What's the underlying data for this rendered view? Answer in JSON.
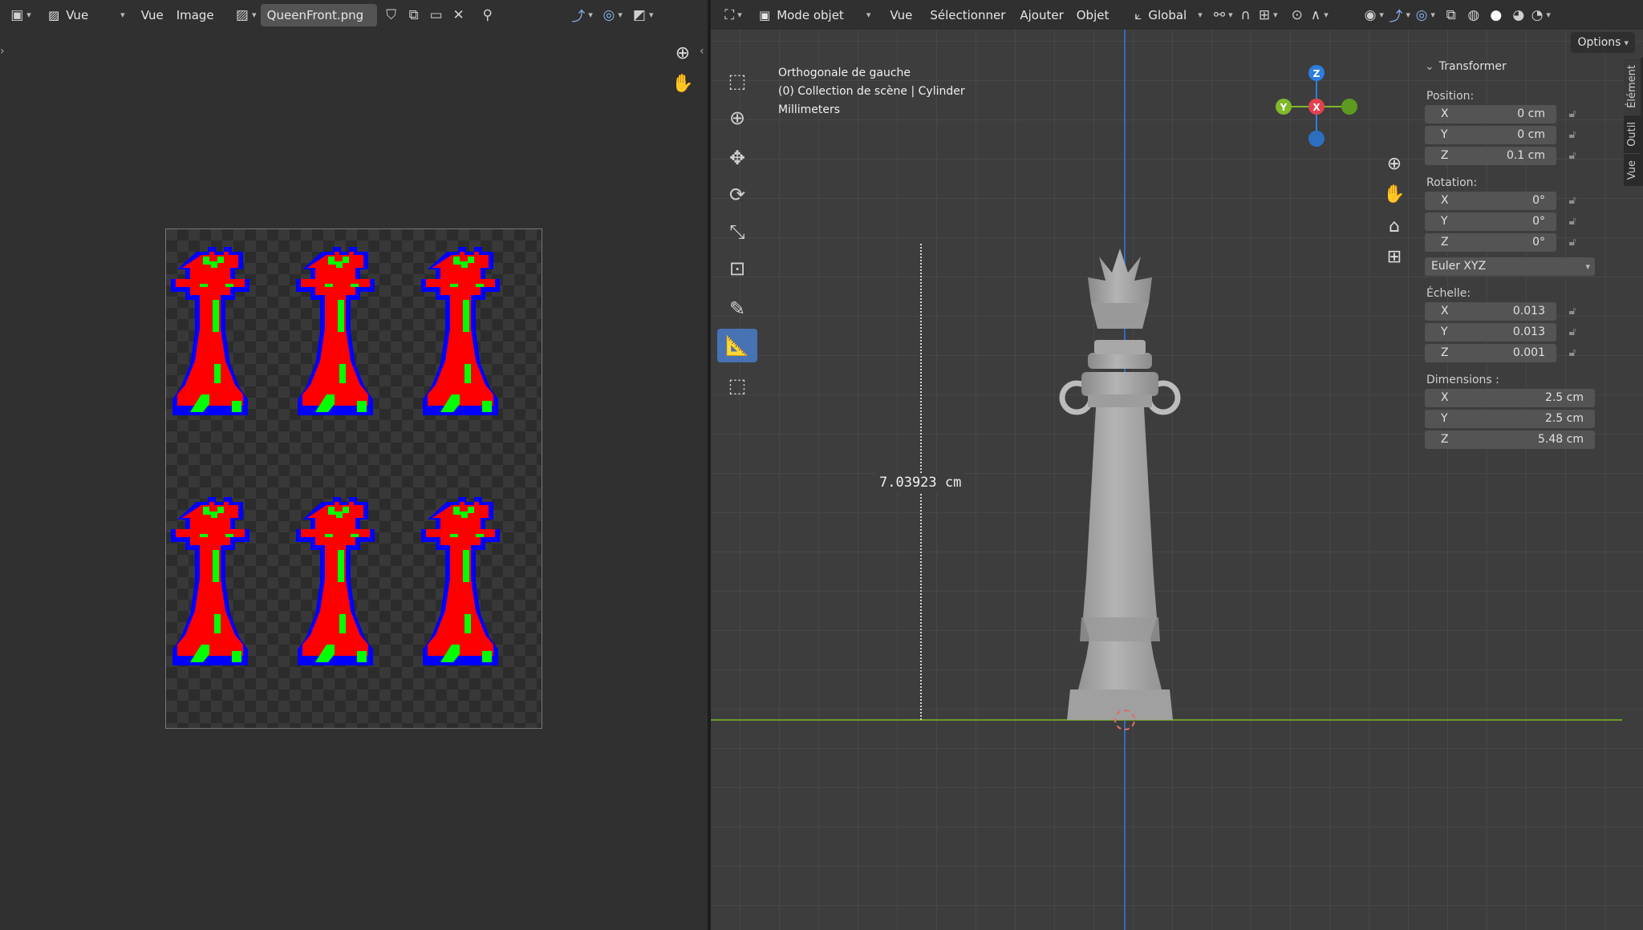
{
  "image_editor": {
    "header": {
      "view_mode": "Vue",
      "menu_view": "Vue",
      "menu_image": "Image",
      "image_name": "QueenFront.png"
    }
  },
  "viewport": {
    "header": {
      "mode": "Mode objet",
      "menus": [
        "Vue",
        "Sélectionner",
        "Ajouter",
        "Objet"
      ],
      "orientation": "Global",
      "options": "Options"
    },
    "overlay": {
      "line1": "Orthogonale de gauche",
      "line2": "(0) Collection de scène | Cylinder",
      "line3": "Millimeters"
    },
    "measurement": "7.03923 cm",
    "gizmo": {
      "z": "Z",
      "x": "X",
      "y": "Y"
    },
    "sidebar_tabs": [
      "Élément",
      "Outil",
      "Vue"
    ]
  },
  "transform_panel": {
    "title": "Transformer",
    "position_label": "Position:",
    "position": [
      {
        "axis": "X",
        "value": "0 cm"
      },
      {
        "axis": "Y",
        "value": "0 cm"
      },
      {
        "axis": "Z",
        "value": "0.1 cm"
      }
    ],
    "rotation_label": "Rotation:",
    "rotation": [
      {
        "axis": "X",
        "value": "0°"
      },
      {
        "axis": "Y",
        "value": "0°"
      },
      {
        "axis": "Z",
        "value": "0°"
      }
    ],
    "rotation_mode": "Euler XYZ",
    "scale_label": "Échelle:",
    "scale": [
      {
        "axis": "X",
        "value": "0.013"
      },
      {
        "axis": "Y",
        "value": "0.013"
      },
      {
        "axis": "Z",
        "value": "0.001"
      }
    ],
    "dimensions_label": "Dimensions :",
    "dimensions": [
      {
        "axis": "X",
        "value": "2.5 cm"
      },
      {
        "axis": "Y",
        "value": "2.5 cm"
      },
      {
        "axis": "Z",
        "value": "5.48 cm"
      }
    ]
  },
  "colors": {
    "active_tool": "#4772b3",
    "axis_x": "#e5404f",
    "axis_y": "#7fb82a",
    "axis_z": "#2c7fe0",
    "sprite_red": "#ff0000",
    "sprite_green": "#00ff00",
    "sprite_blue": "#0000ff"
  }
}
